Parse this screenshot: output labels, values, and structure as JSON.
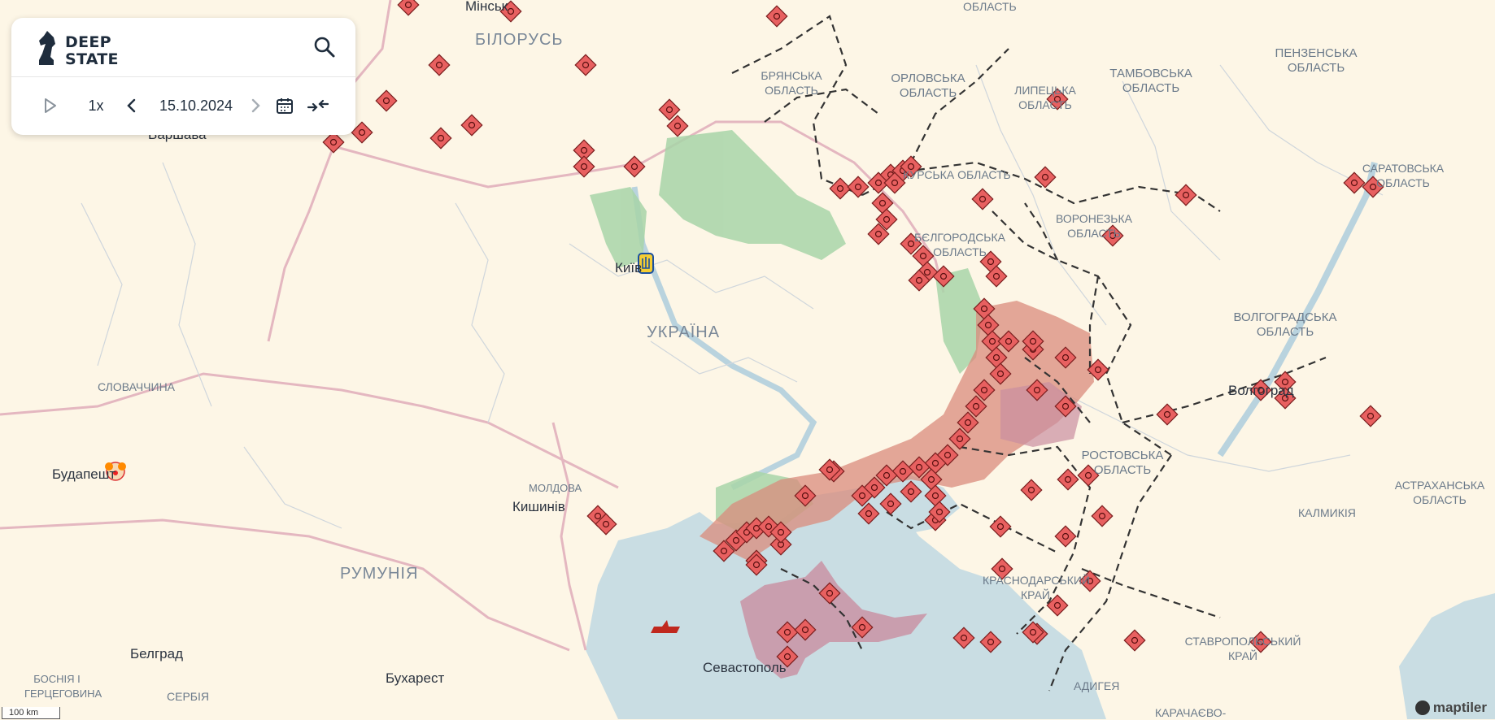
{
  "app": {
    "brand_line1": "DEEP",
    "brand_line2": "STATE"
  },
  "controls": {
    "play_icon": "play-icon",
    "speed": "1x",
    "date": "15.10.2024",
    "calendar_icon": "calendar-icon",
    "collapse_icon": "collapse-arrows-icon",
    "search_icon": "search-icon"
  },
  "map": {
    "labels": {
      "belarus": "БІЛОРУСЬ",
      "ukraine": "УКРАЇНА",
      "romania": "РУМУНІЯ",
      "moldova": "МОЛДОВА",
      "slovakia": "СЛОВАЧЧИНА",
      "bosnia": "БОСНІЯ І ГЕРЦЕГОВИНА",
      "serbia": "СЕРБІЯ",
      "kalmykia": "КАЛМИКІЯ",
      "bryansk": "БРЯНСЬКА ОБЛАСТЬ",
      "oryol": "ОРЛОВСЬКА ОБЛАСТЬ",
      "lipetsk": "ЛИПЕЦЬКА ОБЛАСТЬ",
      "tambov": "ТАМБОВСЬКА ОБЛАСТЬ",
      "penza": "ПЕНЗЕНСЬКА ОБЛАСТЬ",
      "saratov": "САРАТОВСЬКА ОБЛАСТЬ",
      "kursk": "КУРСЬКА ОБЛАСТЬ",
      "voronezh": "ВОРОНЕЗЬКА ОБЛАСТЬ",
      "belgorod": "БЄЛГОРОДСЬКА ОБЛАСТЬ",
      "volgograd": "ВОЛГОГРАДСЬКА ОБЛАСТЬ",
      "rostov": "РОСТОВСЬКА ОБЛАСТЬ",
      "astrakhan": "АСТРАХАНСЬКА ОБЛАСТЬ",
      "krasnodar": "КРАСНОДАРСЬКИЙ КРАЙ",
      "stavropol": "СТАВРОПОЛЬСЬКИЙ КРАЙ",
      "adygea": "АДИГЕЯ",
      "karachay": "КАРАЧАЄВО-",
      "oblast_top": "ОБЛАСТЬ"
    },
    "cities": {
      "minsk": "Мінськ",
      "warsaw": "Варшава",
      "kyiv": "Київ",
      "chisinau": "Кишинів",
      "budapest": "Будапешт",
      "belgrade": "Белград",
      "bucharest": "Бухарест",
      "sevastopol": "Севастополь",
      "volgograd": "Волгоград"
    },
    "scale": "100 km",
    "attribution": "maptiler",
    "colors": {
      "land": "#fdf6e6",
      "sea": "#c9dde3",
      "occupied": "#d98b7c",
      "crimea": "#c98fa0",
      "liberated": "#a8d5a8",
      "marker": "#e86060",
      "border": "#e4b7c0",
      "rail": "#333333"
    }
  }
}
